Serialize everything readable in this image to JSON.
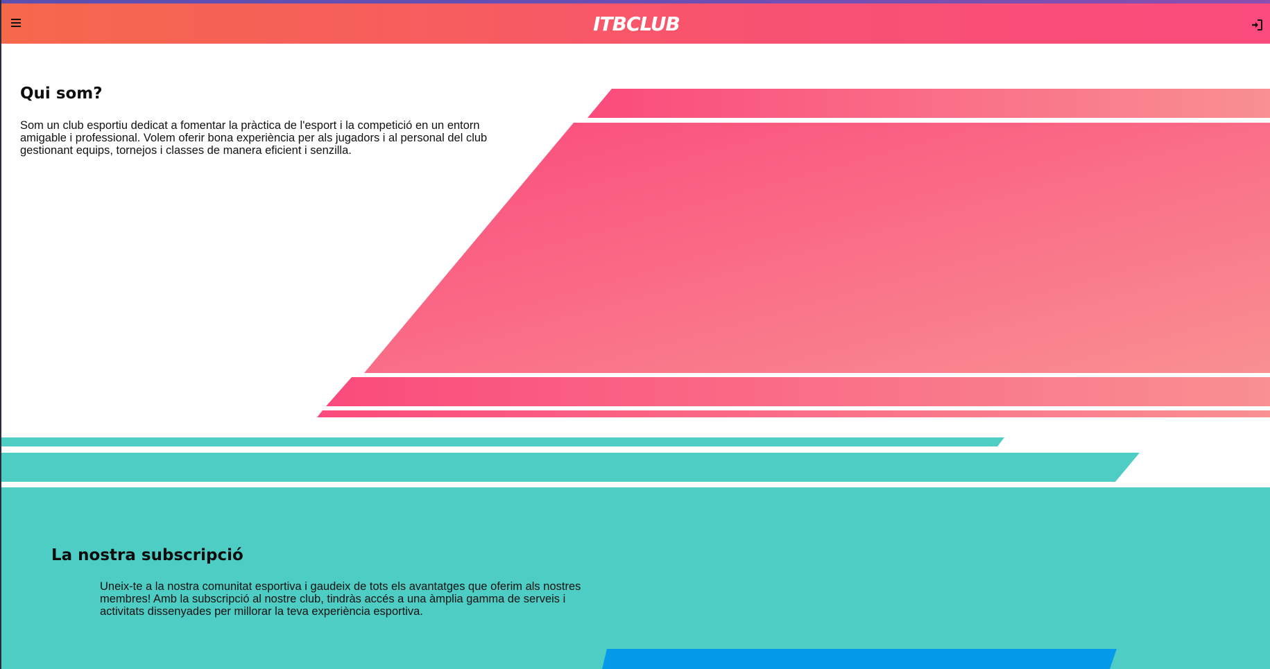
{
  "header": {
    "brand": "ITBCLUB",
    "menu_icon": "hamburger-menu-icon",
    "login_icon": "sign-in-icon",
    "gradient_colors": [
      "#f5684c",
      "#fa4b7c"
    ]
  },
  "about": {
    "title": "Qui som?",
    "text": "Som un club esportiu dedicat a fomentar la pràctica de l'esport i la competició en un entorn amigable i professional. Volem oferir bona experiència per als jugadors i al personal del club gestionant equips, tornejos i classes de manera eficient i senzilla."
  },
  "subscription": {
    "title": "La nostra subscripció",
    "text": "Uneix-te a la nostra comunitat esportiva i gaudeix de tots els avantatges que oferim als nostres membres! Amb la subscripció al nostre club, tindràs accés a una àmplia gamma de serveis i activitats dissenyades per millorar la teva experiència esportiva."
  },
  "colors": {
    "pink_start": "#fa4b7c",
    "pink_end": "#f99092",
    "teal": "#4ecdc4",
    "blue": "#059bea"
  }
}
